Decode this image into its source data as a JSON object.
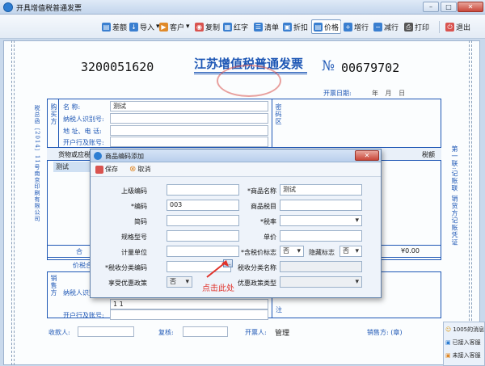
{
  "window": {
    "title": "开具增值税普通发票",
    "min": "–",
    "max": "□",
    "close": "✕"
  },
  "toolbar": {
    "items": [
      {
        "label": "差额"
      },
      {
        "label": "导入"
      },
      {
        "label": "客户"
      },
      {
        "label": "复制"
      },
      {
        "label": "红字"
      },
      {
        "label": "清单"
      },
      {
        "label": "折扣"
      },
      {
        "label": "价格"
      },
      {
        "label": "增行"
      },
      {
        "label": "减行"
      },
      {
        "label": "打印"
      },
      {
        "label": "退出"
      }
    ]
  },
  "invoice": {
    "code": "3200051620",
    "title": "江苏增值税普通发票",
    "no_symbol": "№",
    "number": "00679702",
    "date_label": "开票日期:",
    "date_value": "年  月  日",
    "buyer_side_label": "购买方",
    "buyer_name_label": "名   称:",
    "buyer_name_value": "测试",
    "buyer_taxid_label": "纳税人识别号:",
    "buyer_addr_label": "地 址、电 话:",
    "buyer_bank_label": "开户行及账号:",
    "code_area_label": "密码区",
    "goods_header": "货物或应税",
    "tax_header": "税额",
    "goods_row1": "测试",
    "total_label": "合",
    "total_tax": "¥0.00",
    "price_tax_label": "价税合",
    "seller_side_label": "销售方",
    "seller_taxid_label": "纳税人识别号:",
    "seller_addr_value": "1 1",
    "seller_bank_label": "开户行及账号:",
    "note_label": "注",
    "payee_label": "收款人:",
    "checker_label": "复核:",
    "issuer_label": "开票人:",
    "issuer_value": "管理",
    "seller_sign_label": "销售方: (章)",
    "left_margin_text": "税总函〔2014〕11号南京印刷有限公司",
    "right_margin_text": "第一联:记账联 销货方记账凭证"
  },
  "dialog": {
    "title": "商品编码添加",
    "save_label": "保存",
    "cancel_label": "取消",
    "fields": {
      "parent_code_label": "上级编码",
      "code_label": "*编码",
      "code_value": "003",
      "short_label": "简码",
      "spec_label": "规格型号",
      "unit_label": "计量单位",
      "tax_cat_code_label": "*税收分类编码",
      "tax_cat_code_value": "",
      "pref_label": "享受优惠政策",
      "pref_value": "否",
      "name_label": "*商品名称",
      "name_value": "测试",
      "tax_item_label": "商品税目",
      "rate_label": "*税率",
      "price_label": "单价",
      "incl_tax_label": "*含税价标志",
      "incl_tax_value": "否",
      "hidden_label": "隐藏标志",
      "hidden_value": "否",
      "tax_cat_name_label": "税收分类名称",
      "pref_type_label": "优惠政策类型"
    },
    "hint": "点击此处",
    "browse_btn": "..."
  },
  "tray": {
    "msg": "1005的消息",
    "item1": "已接入客服",
    "item2": "未接入客服"
  },
  "colors": {
    "accent": "#1e57b5",
    "hint": "#e0322a"
  }
}
